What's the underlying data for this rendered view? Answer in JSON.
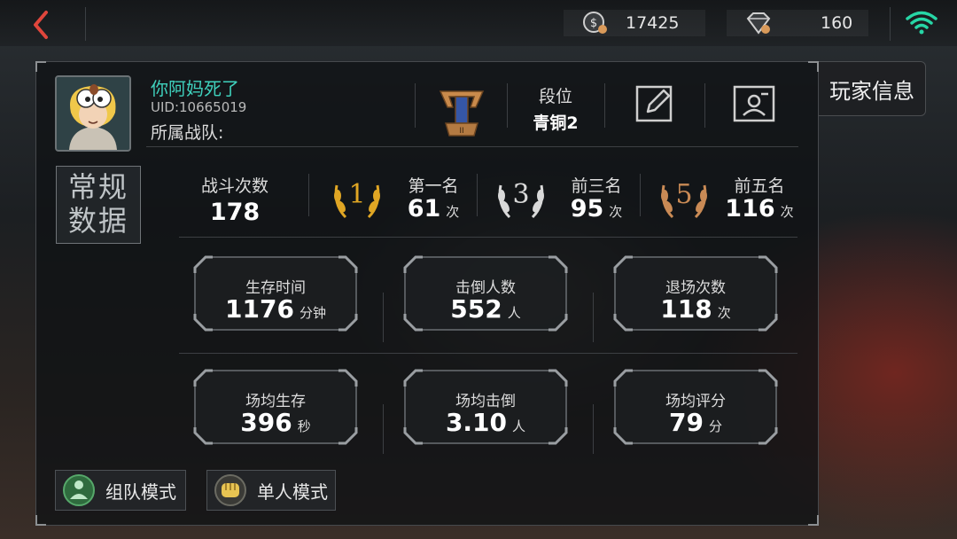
{
  "topbar": {
    "coins": "17425",
    "diamonds": "160",
    "icons": {
      "back": "chevron-left-icon",
      "coin": "coin-icon",
      "diamond": "diamond-icon",
      "wifi": "wifi-icon"
    },
    "wifi_color": "#27d6a6",
    "back_color": "#e0463c"
  },
  "side_tab": {
    "label": "玩家信息"
  },
  "player": {
    "name": "你阿妈死了",
    "uid": "UID:10665019",
    "team_label": "所属战队:"
  },
  "rank": {
    "label": "段位",
    "value": "青铜2"
  },
  "section_tag": "常规 数据",
  "battles": {
    "label": "战斗次数",
    "value": "178"
  },
  "placements": [
    {
      "num": "1",
      "label": "第一名",
      "value": "61",
      "unit": "次",
      "color": "#e0a624"
    },
    {
      "num": "3",
      "label": "前三名",
      "value": "95",
      "unit": "次",
      "color": "#d9d9d9"
    },
    {
      "num": "5",
      "label": "前五名",
      "value": "116",
      "unit": "次",
      "color": "#c98a55"
    }
  ],
  "stats": [
    {
      "label": "生存时间",
      "value": "1176",
      "unit": "分钟"
    },
    {
      "label": "击倒人数",
      "value": "552",
      "unit": "人"
    },
    {
      "label": "退场次数",
      "value": "118",
      "unit": "次"
    },
    {
      "label": "场均生存",
      "value": "396",
      "unit": "秒"
    },
    {
      "label": "场均击倒",
      "value": "3.10",
      "unit": "人"
    },
    {
      "label": "场均评分",
      "value": "79",
      "unit": "分"
    }
  ],
  "modes": [
    {
      "label": "组队模式",
      "icon": "squad-icon"
    },
    {
      "label": "单人模式",
      "icon": "fist-icon"
    }
  ]
}
